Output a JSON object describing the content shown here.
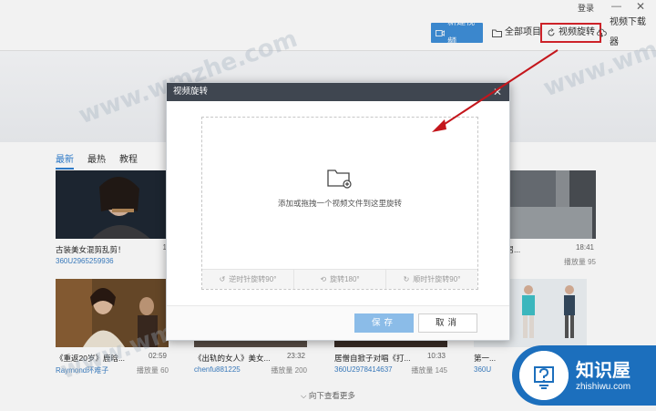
{
  "topbar": {
    "login": "登录",
    "minimize": "—",
    "close": "✕"
  },
  "toolbar": {
    "new_video": "新建视频",
    "all_projects": "全部项目",
    "rotate": "视频旋转",
    "downloader": "视频下载器"
  },
  "tabs": [
    "最新",
    "最热",
    "教程"
  ],
  "cards": [
    {
      "title": "古装美女混剪乱剪！",
      "author": "360U2965259936",
      "plays": "",
      "duration": "1"
    },
    {
      "title": "",
      "author": "",
      "plays": "",
      "duration": ""
    },
    {
      "title": "",
      "author": "",
      "plays": "",
      "duration": ""
    },
    {
      "title": "电瓶车男...",
      "author": "",
      "plays": "播放量 95",
      "duration": "18:41"
    },
    {
      "title": "《重返20岁》鹿晗...",
      "author": "Raymond环难子",
      "plays": "播放量 60",
      "duration": "02:59"
    },
    {
      "title": "《出轨的女人》美女...",
      "author": "chenfu881225",
      "plays": "播放量 200",
      "duration": "23:32"
    },
    {
      "title": "居僧自掀子对唱《打...",
      "author": "360U2978414637",
      "plays": "播放量 145",
      "duration": "10:33"
    },
    {
      "title": "第一...",
      "author": "360U",
      "plays": "",
      "duration": ""
    }
  ],
  "more": "向下查看更多",
  "dialog": {
    "title": "视频旋转",
    "close": "✕",
    "drop_text": "添加或拖拽一个视频文件到这里旋转",
    "rotate_ccw": "逆时针旋转90°",
    "rotate_180": "旋转180°",
    "rotate_cw": "顺时针旋转90°",
    "save": "保存",
    "cancel": "取消"
  },
  "watermark": "www.wmzhe.com",
  "badge": {
    "title": "知识屋",
    "url": "zhishiwu.com"
  },
  "colors": {
    "accent": "#3f8fd8",
    "highlight": "#d8242c",
    "dialog_header": "#3f4650",
    "badge": "#1c6fbd"
  }
}
